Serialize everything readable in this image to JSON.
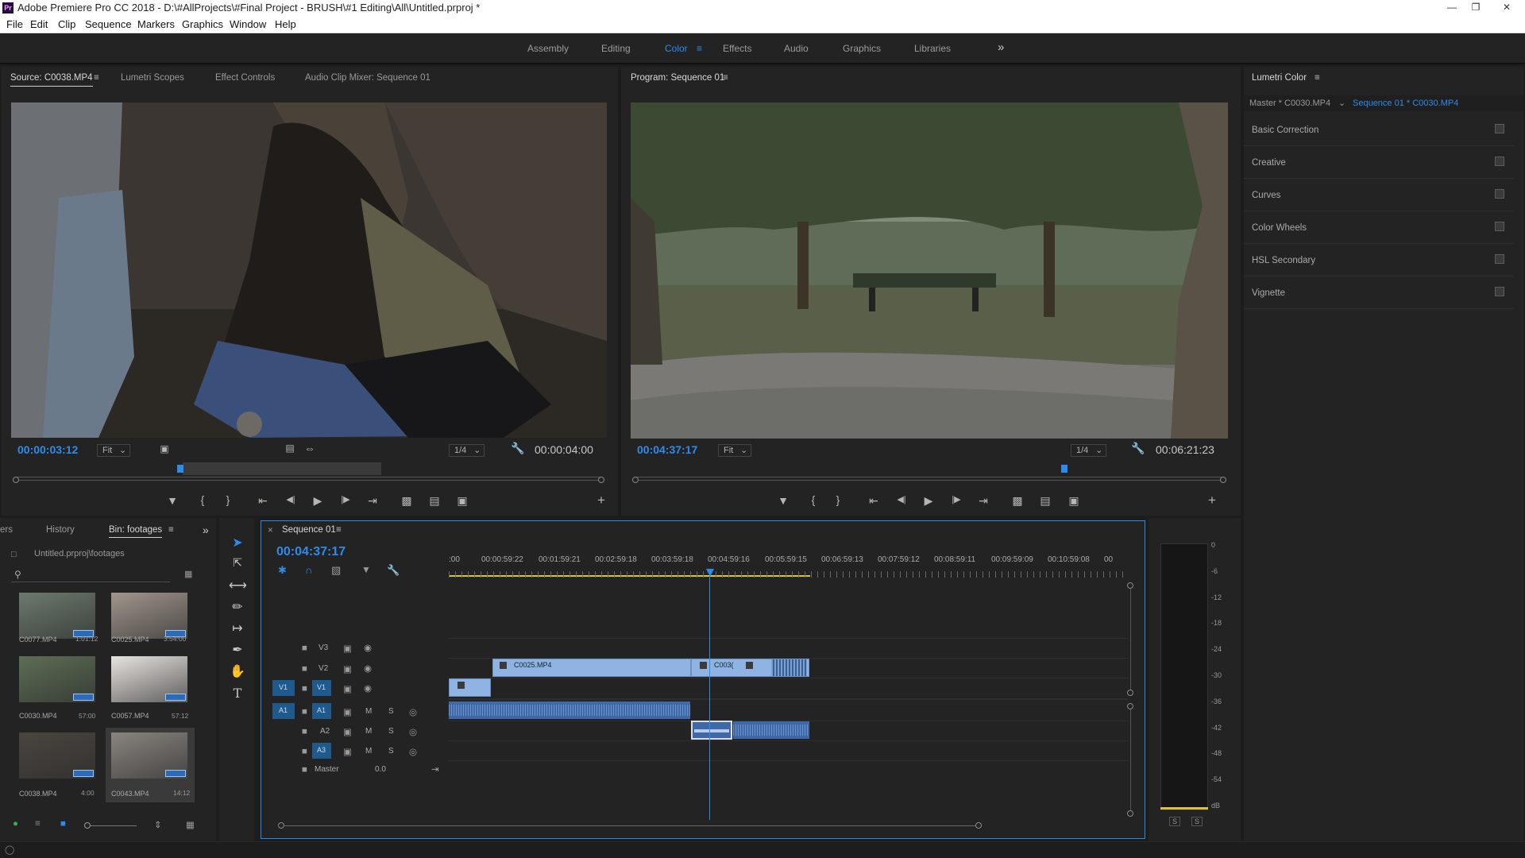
{
  "window": {
    "title": "Adobe Premiere Pro CC 2018 - D:\\#AllProjects\\#Final Project - BRUSH\\#1 Editing\\All\\Untitled.prproj *",
    "app_badge": "Pr"
  },
  "menu": [
    "File",
    "Edit",
    "Clip",
    "Sequence",
    "Markers",
    "Graphics",
    "Window",
    "Help"
  ],
  "workspaces": [
    "Assembly",
    "Editing",
    "Color",
    "Effects",
    "Audio",
    "Graphics",
    "Libraries"
  ],
  "workspace_active": "Color",
  "workspace_more": "»",
  "source_panel": {
    "tabs": [
      "Source: C0038.MP4",
      "Lumetri Scopes",
      "Effect Controls",
      "Audio Clip Mixer: Sequence 01"
    ],
    "timecode": "00:00:03:12",
    "zoom": "Fit",
    "resolution": "1/4",
    "duration": "00:00:04:00",
    "playhead_fraction": 0.28
  },
  "program_panel": {
    "tab": "Program: Sequence 01",
    "timecode": "00:04:37:17",
    "zoom": "Fit",
    "resolution": "1/4",
    "duration": "00:06:21:23",
    "playhead_fraction": 0.73
  },
  "lumetri": {
    "title": "Lumetri Color",
    "master_label": "Master * C0030.MP4",
    "sequence_label": "Sequence 01 * C0030.MP4",
    "sections": [
      "Basic Correction",
      "Creative",
      "Curves",
      "Color Wheels",
      "HSL Secondary",
      "Vignette"
    ]
  },
  "project_panel": {
    "tabs": [
      "ers",
      "History",
      "Bin: footages"
    ],
    "path": "Untitled.prproj\\footages",
    "search_placeholder": "",
    "items": [
      {
        "name": "C0077.MP4",
        "duration": "1:01:12",
        "color": "#6d7a6e"
      },
      {
        "name": "C0025.MP4",
        "duration": "3:54:00",
        "color": "#a0968c"
      },
      {
        "name": "C0030.MP4",
        "duration": "57:00",
        "color": "#5d6e55"
      },
      {
        "name": "C0057.MP4",
        "duration": "57:12",
        "color": "#e8e4e0"
      },
      {
        "name": "C0038.MP4",
        "duration": "4:00",
        "color": "#4a4540"
      },
      {
        "name": "C0043.MP4",
        "duration": "14:12",
        "color": "#8a8580"
      }
    ]
  },
  "timeline": {
    "tab": "Sequence 01",
    "timecode": "00:04:37:17",
    "ruler": [
      ":00",
      "00:00:59:22",
      "00:01:59:21",
      "00:02:59:18",
      "00:03:59:18",
      "00:04:59:16",
      "00:05:59:15",
      "00:06:59:13",
      "00:07:59:12",
      "00:08:59:11",
      "00:09:59:09",
      "00:10:59:08",
      "00"
    ],
    "video_tracks": [
      "V3",
      "V2",
      "V1"
    ],
    "audio_tracks": [
      "A1",
      "A2",
      "A3"
    ],
    "master_label": "Master",
    "master_value": "0.0",
    "clips": {
      "v2_a": "C0025.MP4",
      "v2_b": "C003("
    },
    "track_buttons": {
      "mute": "M",
      "solo": "S"
    }
  },
  "meter": {
    "scale": [
      "0",
      "-6",
      "-12",
      "-18",
      "-24",
      "-30",
      "-36",
      "-42",
      "-48",
      "-54",
      "dB"
    ],
    "solo_labels": [
      "S",
      "S"
    ]
  },
  "colors": {
    "accent": "#2d8ceb",
    "panel": "#232323",
    "bg": "#1d1d1d",
    "clip_video": "#8fb3e2",
    "clip_audio": "#3f68a8",
    "playhead": "#2d8ceb"
  }
}
